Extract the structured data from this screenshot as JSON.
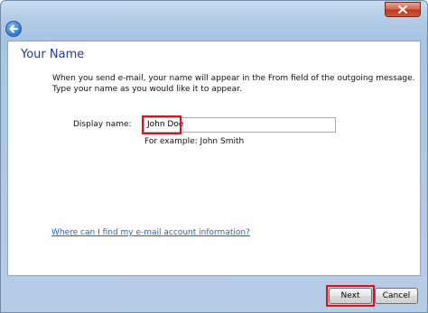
{
  "window": {
    "close_icon": "close-x-icon",
    "back_icon": "back-arrow-icon"
  },
  "page": {
    "title": "Your Name",
    "description_line1": "When you send e-mail, your name will appear in the From field of the outgoing message.",
    "description_line2": "Type your name as you would like it to appear."
  },
  "form": {
    "display_name_label": "Display name:",
    "display_name_value": "John Doe",
    "example_text": "For example: John Smith"
  },
  "help_link": "Where can I find my e-mail account information?",
  "buttons": {
    "next_label": "Next",
    "cancel_label": "Cancel"
  },
  "colors": {
    "highlight": "#e0101a",
    "title": "#1e3d8f",
    "link": "#2561c4"
  }
}
